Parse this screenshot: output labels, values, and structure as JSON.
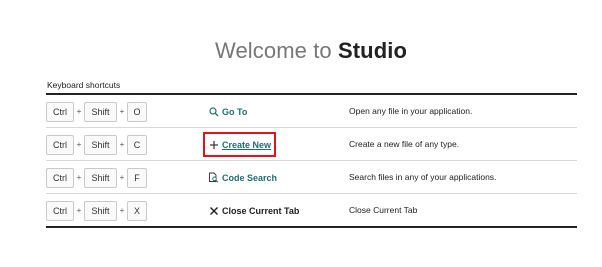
{
  "header": {
    "prefix": "Welcome to ",
    "brand": "Studio"
  },
  "section": {
    "label": "Keyboard shortcuts"
  },
  "shortcuts": [
    {
      "keys": [
        "Ctrl",
        "Shift",
        "O"
      ],
      "plus": "+",
      "action": "Go To",
      "icon": "search-icon",
      "description": "Open any file in your application."
    },
    {
      "keys": [
        "Ctrl",
        "Shift",
        "C"
      ],
      "plus": "+",
      "action": "Create New",
      "icon": "plus-icon",
      "description": "Create a new file of any type."
    },
    {
      "keys": [
        "Ctrl",
        "Shift",
        "F"
      ],
      "plus": "+",
      "action": "Code Search",
      "icon": "file-search-icon",
      "description": "Search files in any of your applications."
    },
    {
      "keys": [
        "Ctrl",
        "Shift",
        "X"
      ],
      "plus": "+",
      "action": "Close Current Tab",
      "icon": "close-icon",
      "description": "Close Current Tab"
    }
  ],
  "colors": {
    "accent": "#1f6f70",
    "highlight": "#e2131d"
  }
}
